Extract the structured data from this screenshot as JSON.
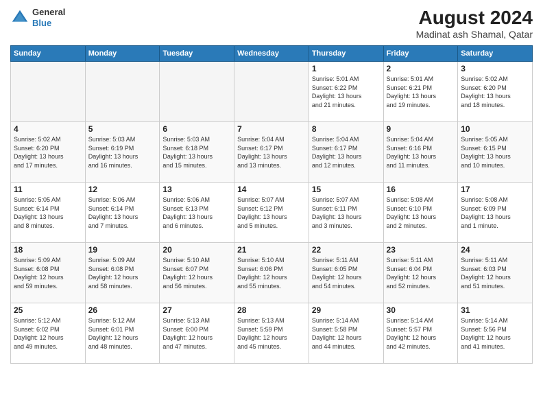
{
  "header": {
    "logo_general": "General",
    "logo_blue": "Blue",
    "month_year": "August 2024",
    "location": "Madinat ash Shamal, Qatar"
  },
  "weekdays": [
    "Sunday",
    "Monday",
    "Tuesday",
    "Wednesday",
    "Thursday",
    "Friday",
    "Saturday"
  ],
  "weeks": [
    [
      {
        "day": "",
        "info": ""
      },
      {
        "day": "",
        "info": ""
      },
      {
        "day": "",
        "info": ""
      },
      {
        "day": "",
        "info": ""
      },
      {
        "day": "1",
        "info": "Sunrise: 5:01 AM\nSunset: 6:22 PM\nDaylight: 13 hours\nand 21 minutes."
      },
      {
        "day": "2",
        "info": "Sunrise: 5:01 AM\nSunset: 6:21 PM\nDaylight: 13 hours\nand 19 minutes."
      },
      {
        "day": "3",
        "info": "Sunrise: 5:02 AM\nSunset: 6:20 PM\nDaylight: 13 hours\nand 18 minutes."
      }
    ],
    [
      {
        "day": "4",
        "info": "Sunrise: 5:02 AM\nSunset: 6:20 PM\nDaylight: 13 hours\nand 17 minutes."
      },
      {
        "day": "5",
        "info": "Sunrise: 5:03 AM\nSunset: 6:19 PM\nDaylight: 13 hours\nand 16 minutes."
      },
      {
        "day": "6",
        "info": "Sunrise: 5:03 AM\nSunset: 6:18 PM\nDaylight: 13 hours\nand 15 minutes."
      },
      {
        "day": "7",
        "info": "Sunrise: 5:04 AM\nSunset: 6:17 PM\nDaylight: 13 hours\nand 13 minutes."
      },
      {
        "day": "8",
        "info": "Sunrise: 5:04 AM\nSunset: 6:17 PM\nDaylight: 13 hours\nand 12 minutes."
      },
      {
        "day": "9",
        "info": "Sunrise: 5:04 AM\nSunset: 6:16 PM\nDaylight: 13 hours\nand 11 minutes."
      },
      {
        "day": "10",
        "info": "Sunrise: 5:05 AM\nSunset: 6:15 PM\nDaylight: 13 hours\nand 10 minutes."
      }
    ],
    [
      {
        "day": "11",
        "info": "Sunrise: 5:05 AM\nSunset: 6:14 PM\nDaylight: 13 hours\nand 8 minutes."
      },
      {
        "day": "12",
        "info": "Sunrise: 5:06 AM\nSunset: 6:14 PM\nDaylight: 13 hours\nand 7 minutes."
      },
      {
        "day": "13",
        "info": "Sunrise: 5:06 AM\nSunset: 6:13 PM\nDaylight: 13 hours\nand 6 minutes."
      },
      {
        "day": "14",
        "info": "Sunrise: 5:07 AM\nSunset: 6:12 PM\nDaylight: 13 hours\nand 5 minutes."
      },
      {
        "day": "15",
        "info": "Sunrise: 5:07 AM\nSunset: 6:11 PM\nDaylight: 13 hours\nand 3 minutes."
      },
      {
        "day": "16",
        "info": "Sunrise: 5:08 AM\nSunset: 6:10 PM\nDaylight: 13 hours\nand 2 minutes."
      },
      {
        "day": "17",
        "info": "Sunrise: 5:08 AM\nSunset: 6:09 PM\nDaylight: 13 hours\nand 1 minute."
      }
    ],
    [
      {
        "day": "18",
        "info": "Sunrise: 5:09 AM\nSunset: 6:08 PM\nDaylight: 12 hours\nand 59 minutes."
      },
      {
        "day": "19",
        "info": "Sunrise: 5:09 AM\nSunset: 6:08 PM\nDaylight: 12 hours\nand 58 minutes."
      },
      {
        "day": "20",
        "info": "Sunrise: 5:10 AM\nSunset: 6:07 PM\nDaylight: 12 hours\nand 56 minutes."
      },
      {
        "day": "21",
        "info": "Sunrise: 5:10 AM\nSunset: 6:06 PM\nDaylight: 12 hours\nand 55 minutes."
      },
      {
        "day": "22",
        "info": "Sunrise: 5:11 AM\nSunset: 6:05 PM\nDaylight: 12 hours\nand 54 minutes."
      },
      {
        "day": "23",
        "info": "Sunrise: 5:11 AM\nSunset: 6:04 PM\nDaylight: 12 hours\nand 52 minutes."
      },
      {
        "day": "24",
        "info": "Sunrise: 5:11 AM\nSunset: 6:03 PM\nDaylight: 12 hours\nand 51 minutes."
      }
    ],
    [
      {
        "day": "25",
        "info": "Sunrise: 5:12 AM\nSunset: 6:02 PM\nDaylight: 12 hours\nand 49 minutes."
      },
      {
        "day": "26",
        "info": "Sunrise: 5:12 AM\nSunset: 6:01 PM\nDaylight: 12 hours\nand 48 minutes."
      },
      {
        "day": "27",
        "info": "Sunrise: 5:13 AM\nSunset: 6:00 PM\nDaylight: 12 hours\nand 47 minutes."
      },
      {
        "day": "28",
        "info": "Sunrise: 5:13 AM\nSunset: 5:59 PM\nDaylight: 12 hours\nand 45 minutes."
      },
      {
        "day": "29",
        "info": "Sunrise: 5:14 AM\nSunset: 5:58 PM\nDaylight: 12 hours\nand 44 minutes."
      },
      {
        "day": "30",
        "info": "Sunrise: 5:14 AM\nSunset: 5:57 PM\nDaylight: 12 hours\nand 42 minutes."
      },
      {
        "day": "31",
        "info": "Sunrise: 5:14 AM\nSunset: 5:56 PM\nDaylight: 12 hours\nand 41 minutes."
      }
    ]
  ]
}
